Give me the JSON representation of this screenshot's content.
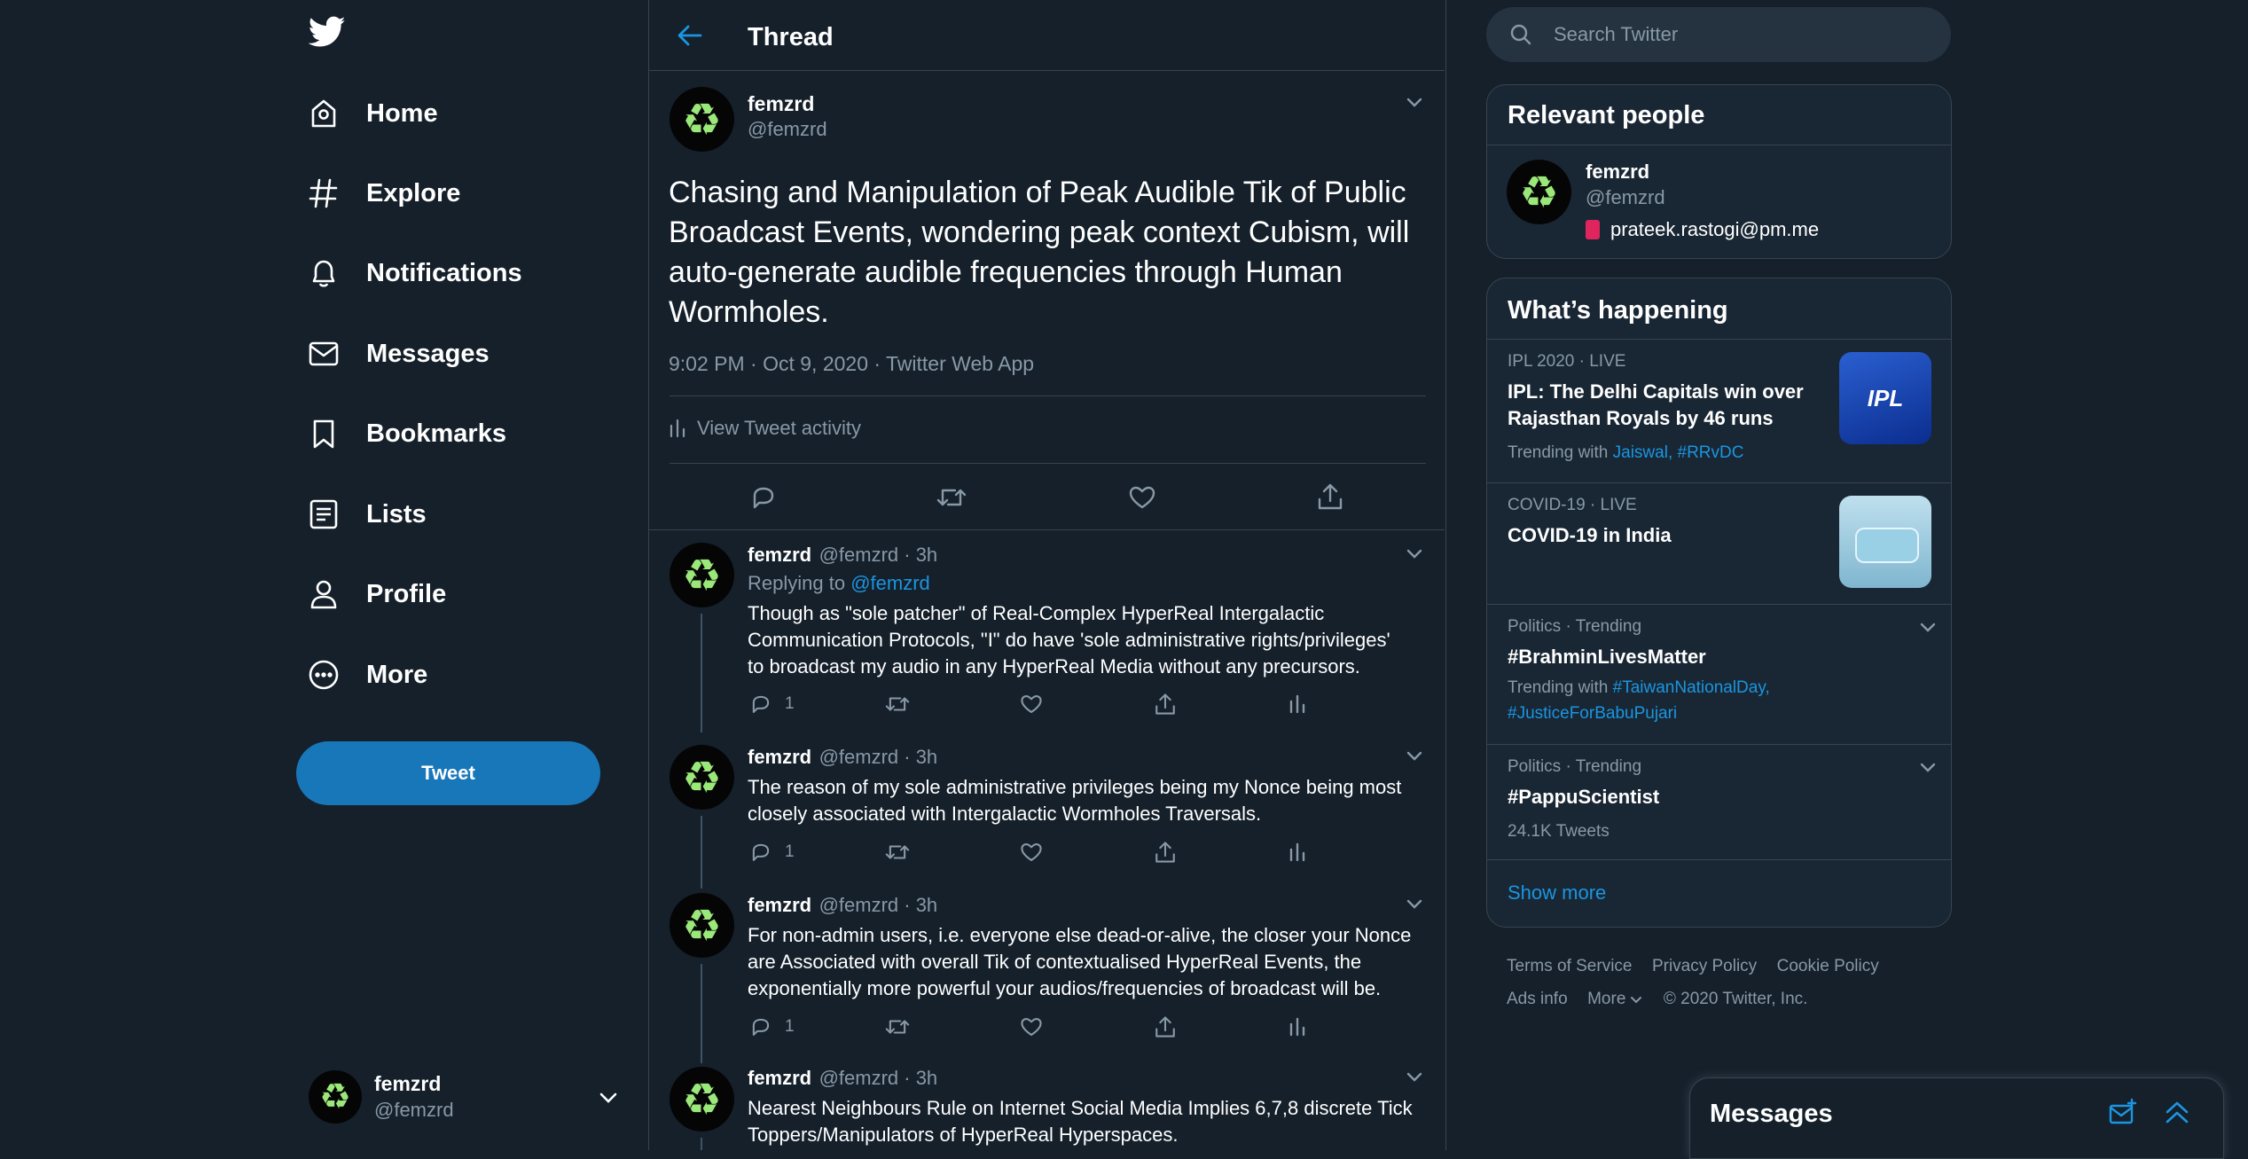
{
  "nav": {
    "items": [
      {
        "label": "Home",
        "icon": "home-icon"
      },
      {
        "label": "Explore",
        "icon": "hashtag-icon"
      },
      {
        "label": "Notifications",
        "icon": "bell-icon"
      },
      {
        "label": "Messages",
        "icon": "envelope-icon"
      },
      {
        "label": "Bookmarks",
        "icon": "bookmark-icon"
      },
      {
        "label": "Lists",
        "icon": "list-icon"
      },
      {
        "label": "Profile",
        "icon": "person-icon"
      },
      {
        "label": "More",
        "icon": "more-circle-icon"
      }
    ],
    "tweet_button": "Tweet",
    "account": {
      "name": "femzrd",
      "handle": "@femzrd"
    }
  },
  "header": {
    "title": "Thread"
  },
  "main_tweet": {
    "name": "femzrd",
    "handle": "@femzrd",
    "text": "Chasing and Manipulation of Peak Audible Tik of Public Broadcast Events, wondering peak context Cubism, will auto-generate audible frequencies through Human Wormholes.",
    "meta": "9:02 PM · Oct 9, 2020 · Twitter Web App",
    "activity": "View Tweet activity"
  },
  "replies": [
    {
      "name": "femzrd",
      "meta": "@femzrd · 3h",
      "replying_prefix": "Replying to ",
      "replying_to": "@femzrd",
      "text_lines": [
        "Though as \"sole patcher\" of Real-Complex HyperReal Intergalactic",
        "Communication Protocols, \"I\" do have 'sole administrative rights/privileges'",
        "to broadcast my audio in any HyperReal Media without any precursors."
      ],
      "reply_count": "1"
    },
    {
      "name": "femzrd",
      "meta": "@femzrd · 3h",
      "text_lines": [
        "The reason of my sole administrative privileges being my Nonce being most",
        "closely associated with Intergalactic Wormholes Traversals."
      ],
      "reply_count": "1"
    },
    {
      "name": "femzrd",
      "meta": "@femzrd · 3h",
      "text_lines": [
        "For non-admin users, i.e. everyone else dead-or-alive, the closer your Nonce",
        "are Associated with overall Tik of contextualised HyperReal Events, the",
        "exponentially more powerful your audios/frequencies of broadcast will be."
      ],
      "reply_count": "1"
    },
    {
      "name": "femzrd",
      "meta": "@femzrd · 3h",
      "text_lines": [
        "Nearest Neighbours Rule on Internet Social Media Implies 6,7,8 discrete Tick",
        "Toppers/Manipulators of HyperReal Hyperspaces."
      ]
    }
  ],
  "search": {
    "placeholder": "Search Twitter"
  },
  "relevant_people": {
    "title": "Relevant people",
    "name": "femzrd",
    "handle": "@femzrd",
    "bio": "prateek.rastogi@pm.me"
  },
  "whats_happening": {
    "title": "What’s happening",
    "trends": [
      {
        "category": "IPL 2020 · LIVE",
        "title_lines": [
          "IPL: The Delhi Capitals win over",
          "Rajasthan Royals by 46 runs"
        ],
        "trending_prefix": "Trending with ",
        "trending_links": "Jaiswal, #RRvDC",
        "image_text": "IPL"
      },
      {
        "category": "COVID-19 · LIVE",
        "title_lines": [
          "COVID-19 in India"
        ]
      },
      {
        "category": "Politics · Trending",
        "title_lines": [
          "#BrahminLivesMatter"
        ],
        "trending_prefix": "Trending with ",
        "trending_links": "#TaiwanNationalDay,",
        "trending_links_2": "#JusticeForBabuPujari"
      },
      {
        "category": "Politics · Trending",
        "title_lines": [
          "#PappuScientist"
        ],
        "count": "24.1K Tweets"
      }
    ],
    "show_more": "Show more"
  },
  "footer": {
    "links": [
      "Terms of Service",
      "Privacy Policy",
      "Cookie Policy"
    ],
    "ads": "Ads info",
    "more": "More",
    "copyright": "© 2020 Twitter, Inc."
  },
  "messages_drawer": {
    "title": "Messages"
  },
  "colors": {
    "background": "#15202b",
    "accent": "#1b95e0",
    "tweet_button": "#1877b8",
    "card": "#192734",
    "muted": "#8899a6",
    "border": "#38444d",
    "avatar_glyph": "#9be87a"
  }
}
